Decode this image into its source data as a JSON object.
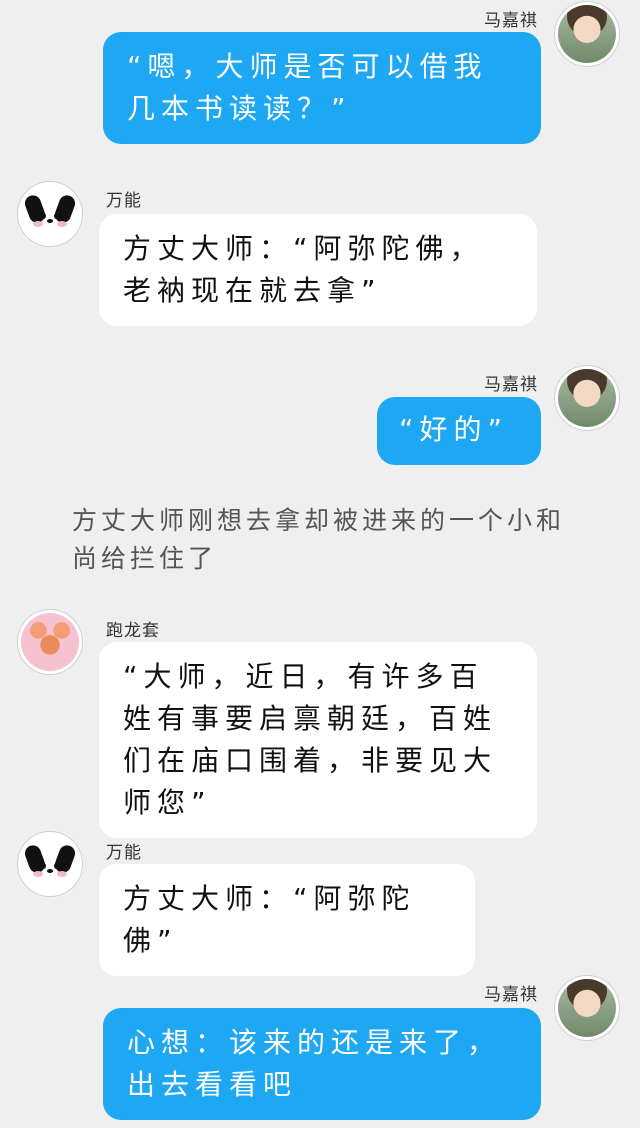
{
  "messages": [
    {
      "side": "right",
      "name": "马嘉祺",
      "avatar": "person-avatar",
      "text": "“嗯，大师是否可以借我几本书读读？”"
    },
    {
      "side": "left",
      "name": "万能",
      "avatar": "dog-avatar",
      "text": "方丈大师：“阿弥陀佛，老衲现在就去拿”"
    },
    {
      "side": "right",
      "name": "马嘉祺",
      "avatar": "person-avatar",
      "text": "“好的”"
    },
    {
      "type": "narration",
      "text": "方丈大师刚想去拿却被进来的一个小和尚给拦住了"
    },
    {
      "side": "left",
      "name": "跑龙套",
      "avatar": "bear-avatar",
      "text": "“大师，近日，有许多百姓有事要启禀朝廷，百姓们在庙口围着，非要见大师您”"
    },
    {
      "side": "left",
      "name": "万能",
      "avatar": "dog-avatar",
      "text": "方丈大师：“阿弥陀佛”"
    },
    {
      "side": "right",
      "name": "马嘉祺",
      "avatar": "person-avatar",
      "text": "心想：该来的还是来了，出去看看吧"
    }
  ],
  "colors": {
    "self_bubble": "#1ea7f2",
    "other_bubble": "#ffffff",
    "background": "#efefef"
  }
}
